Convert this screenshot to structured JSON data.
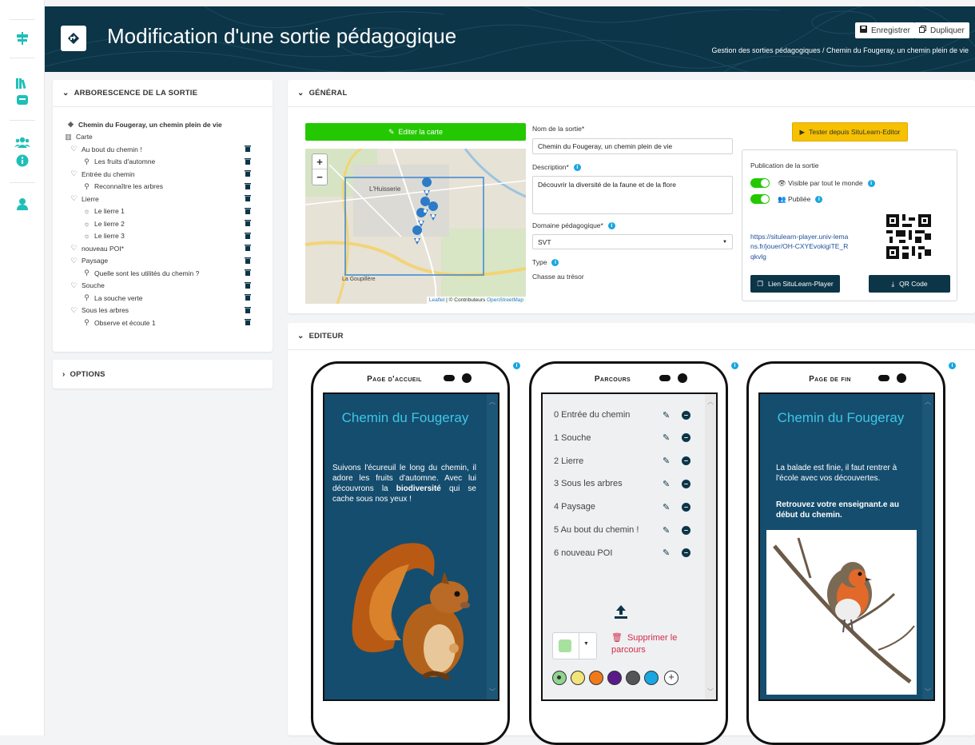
{
  "header": {
    "title": "Modification d'une sortie pédagogique",
    "save_label": "Enregistrer",
    "duplicate_label": "Dupliquer",
    "breadcrumb": "Gestion des sorties pédagogiques / Chemin du Fougeray, un chemin plein de vie"
  },
  "sidebar": {
    "icons": [
      "signpost-icon",
      "books-icon",
      "inbox-icon",
      "users-icon",
      "info-icon",
      "user-icon"
    ]
  },
  "tree_panel": {
    "title": "ARBORESCENCE DE LA SORTIE",
    "root": "Chemin du Fougeray, un chemin plein de vie",
    "map_label": "Carte",
    "items": [
      {
        "label": "Au bout du chemin !",
        "level": 1,
        "icon": "pin"
      },
      {
        "label": "Les fruits d'automne",
        "level": 2,
        "icon": "search"
      },
      {
        "label": "Entrée du chemin",
        "level": 1,
        "icon": "pin"
      },
      {
        "label": "Reconnaître les arbres",
        "level": 2,
        "icon": "search"
      },
      {
        "label": "Lierre",
        "level": 1,
        "icon": "pin"
      },
      {
        "label": "Le lierre 1",
        "level": 2,
        "icon": "bulb"
      },
      {
        "label": "Le lierre 2",
        "level": 2,
        "icon": "bulb"
      },
      {
        "label": "Le lierre 3",
        "level": 2,
        "icon": "bulb"
      },
      {
        "label": "nouveau POI*",
        "level": 1,
        "icon": "pin"
      },
      {
        "label": "Paysage",
        "level": 1,
        "icon": "pin"
      },
      {
        "label": "Quelle sont les utilités du chemin ?",
        "level": 2,
        "icon": "search"
      },
      {
        "label": "Souche",
        "level": 1,
        "icon": "pin"
      },
      {
        "label": "La souche verte",
        "level": 2,
        "icon": "search"
      },
      {
        "label": "Sous les arbres",
        "level": 1,
        "icon": "pin"
      },
      {
        "label": "Observe et écoute 1",
        "level": 2,
        "icon": "search"
      }
    ]
  },
  "options_panel": {
    "title": "OPTIONS"
  },
  "general": {
    "title": "GÉNÉRAL",
    "edit_map_label": "Editer la carte",
    "map": {
      "zoom_in": "+",
      "zoom_out": "−",
      "place_1": "L'Huisserie",
      "place_2": "La Goupillère",
      "attribution_leaflet": "Leaflet",
      "attribution_rest": " | © Contributeurs ",
      "attribution_osm": "OpenStreetMap"
    },
    "name_label": "Nom de la sortie*",
    "name_value": "Chemin du Fougeray, un chemin plein de vie",
    "description_label": "Description*",
    "description_value": "Découvrir la diversité de la faune et de la flore",
    "domain_label": "Domaine pédagogique*",
    "domain_value": "SVT",
    "type_label": "Type",
    "type_value": "Chasse au trésor",
    "test_button": "Tester depuis SituLearn-Editor",
    "publication_title": "Publication de la sortie",
    "visible_label": "Visible par tout le monde",
    "published_label": "Publiée",
    "url": "https://situlearn-player.univ-lemans.fr/jouer/OH-CXYEvokigiTE_Rqkvlg",
    "player_link_label": "Lien SituLearn-Player",
    "qr_label": "QR Code"
  },
  "editor": {
    "title": "EDITEUR",
    "home": {
      "header": "Page d'accueil",
      "title": "Chemin du Fougeray",
      "text_1": "Suivons l'écureuil le long du chemin, il adore les fruits d'automne. Avec lui découvrons la ",
      "text_bold": "biodiversité",
      "text_2": " qui se cache sous nos yeux !"
    },
    "parcours": {
      "header": "Parcours",
      "items": [
        "0 Entrée du chemin",
        "1 Souche",
        "2 Lierre",
        "3 Sous les arbres",
        "4 Paysage",
        "5 Au bout du chemin !",
        "6 nouveau POI"
      ],
      "delete_label": "Supprimer le parcours",
      "swatches": [
        "#8fd48f",
        "#f2e37a",
        "#f07a1a",
        "#5a1a8a",
        "#555555",
        "#1aa6e0"
      ],
      "selected_color": "#a8e0a0"
    },
    "end": {
      "header": "Page de fin",
      "title": "Chemin du Fougeray",
      "text_1": "La balade est finie, il faut rentrer à l'école avec vos découvertes.",
      "text_2": "Retrouvez votre enseignant.e au début du chemin."
    }
  }
}
